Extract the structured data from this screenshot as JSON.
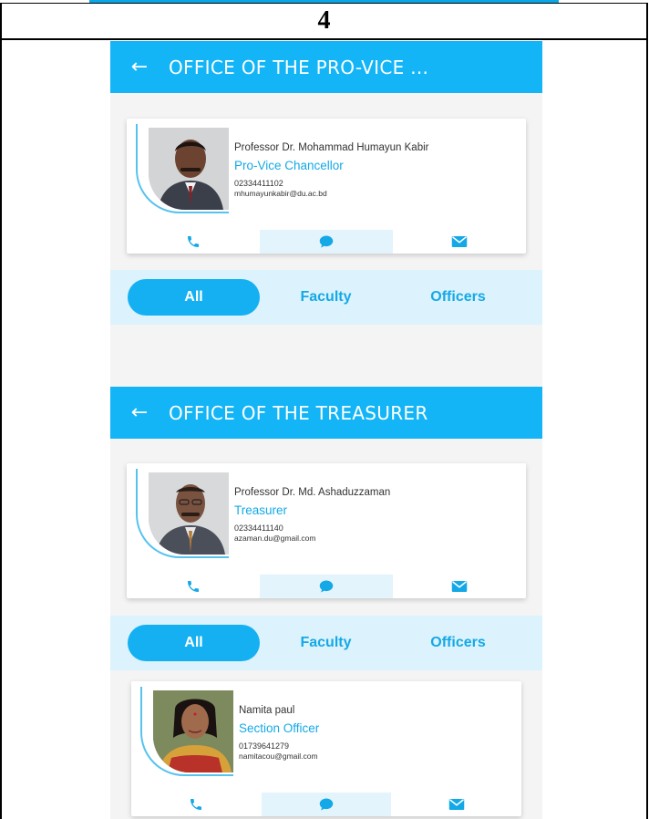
{
  "page": {
    "number": "4"
  },
  "screens": [
    {
      "appbar_title": "OFFICE OF THE PRO-VICE ...",
      "person": {
        "name": "Professor Dr. Mohammad Humayun Kabir",
        "role": "Pro-Vice Chancellor",
        "phone": "02334411102",
        "email": "mhumayunkabir@du.ac.bd"
      },
      "tabs": [
        "All",
        "Faculty",
        "Officers"
      ],
      "active_tab": "All"
    },
    {
      "appbar_title": "OFFICE OF THE TREASURER",
      "person": {
        "name": "Professor Dr. Md. Ashaduzzaman",
        "role": "Treasurer",
        "phone": "02334411140",
        "email": "azaman.du@gmail.com"
      },
      "tabs": [
        "All",
        "Faculty",
        "Officers"
      ],
      "active_tab": "All",
      "list": [
        {
          "name": "Namita paul",
          "role": "Section Officer",
          "phone": "01739641279",
          "email": "namitacou@gmail.com"
        }
      ]
    }
  ],
  "icons": {
    "back": "arrow-left-icon",
    "call": "phone-icon",
    "message": "chat-bubble-icon",
    "mail": "envelope-icon"
  },
  "colors": {
    "primary": "#13b5f6",
    "accent_text": "#14a9e6",
    "tab_bar": "#dcf2fd",
    "action_mid": "#e3f4fd"
  }
}
